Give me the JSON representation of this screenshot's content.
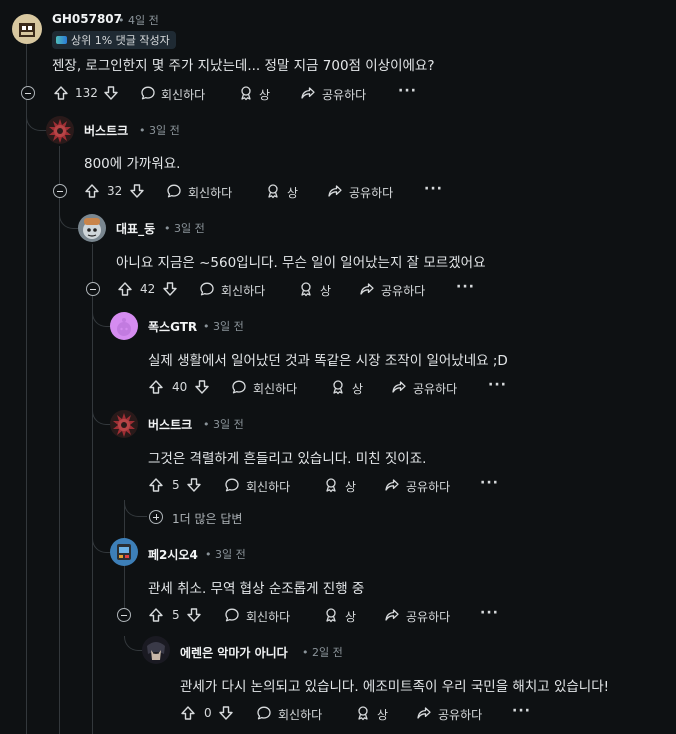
{
  "labels": {
    "reply": "회신하다",
    "award": "상",
    "share": "공유하다",
    "more": "···"
  },
  "comments": [
    {
      "author": "GH057807",
      "time": "• 4일 전",
      "badge": "상위 1% 댓글 작성자",
      "body": "젠장, 로그인한지 몇 주가 지났는데... 정말 지금 700점 이상이에요?",
      "votes": "132"
    },
    {
      "author": "버스트크",
      "time": "• 3일 전",
      "body": "800에 가까워요.",
      "votes": "32"
    },
    {
      "author": "대표_둥",
      "time": "• 3일 전",
      "body": "아니요 지금은 ~560입니다. 무슨 일이 일어났는지 잘 모르겠어요",
      "votes": "42"
    },
    {
      "author": "폭스GTR",
      "time": "• 3일 전",
      "body": "실제 생활에서 일어났던 것과 똑같은 시장 조작이 일어났네요 ;D",
      "votes": "40"
    },
    {
      "author": "버스트크",
      "time": "• 3일 전",
      "body": "그것은 격렬하게 흔들리고 있습니다. 미친 짓이죠.",
      "votes": "5"
    },
    {
      "author": "페2시오4",
      "time": "• 3일 전",
      "body": "관세 취소. 무역 협상 순조롭게 진행 중",
      "votes": "5"
    },
    {
      "author": "에렌은 악마가 아니다",
      "time": "• 2일 전",
      "body": "관세가 다시 논의되고 있습니다. 에조미트족이 우리 국민을 해치고 있습니다!",
      "votes": "0"
    }
  ],
  "more_replies": "1더 많은 답변",
  "colors": {
    "background": "#0e1113",
    "text": "#d7dadc",
    "muted": "#8b949a",
    "thread_line": "#33383c"
  }
}
